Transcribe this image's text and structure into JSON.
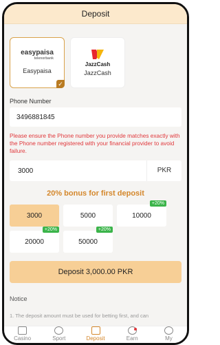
{
  "header": {
    "title": "Deposit"
  },
  "methods": [
    {
      "label": "Easypaisa",
      "logo_text": "easypaisa",
      "logo_sub": "telenorbank",
      "selected": true
    },
    {
      "label": "JazzCash",
      "logo_text": "JazzCash",
      "selected": false
    }
  ],
  "phone": {
    "label": "Phone Number",
    "value": "3496881845",
    "warning": "Please ensure the Phone number you provide matches exactly with the Phone number registered with your financial provider to avoid failure."
  },
  "amount": {
    "value": "3000",
    "currency": "PKR"
  },
  "bonus_text": "20% bonus for first deposit",
  "chips": [
    {
      "label": "3000",
      "active": true,
      "tag": ""
    },
    {
      "label": "5000",
      "active": false,
      "tag": ""
    },
    {
      "label": "10000",
      "active": false,
      "tag": "+20%"
    },
    {
      "label": "20000",
      "active": false,
      "tag": "+20%"
    },
    {
      "label": "50000",
      "active": false,
      "tag": "+20%"
    }
  ],
  "deposit_button": "Deposit 3,000.00 PKR",
  "notice": {
    "title": "Notice",
    "text": "1. The deposit amount must be used for betting first, and can"
  },
  "tabs": [
    {
      "label": "Casino",
      "icon": "casino-icon"
    },
    {
      "label": "Sport",
      "icon": "sport-icon"
    },
    {
      "label": "Deposit",
      "icon": "wallet-icon",
      "active": true
    },
    {
      "label": "Earn",
      "icon": "coin-icon",
      "badge": true
    },
    {
      "label": "My",
      "icon": "user-icon"
    }
  ],
  "colors": {
    "accent": "#d4872b",
    "header_bg": "#fce9cc",
    "chip_active": "#f7cf96",
    "warning": "#e0373b",
    "tag": "#3bb44a"
  }
}
